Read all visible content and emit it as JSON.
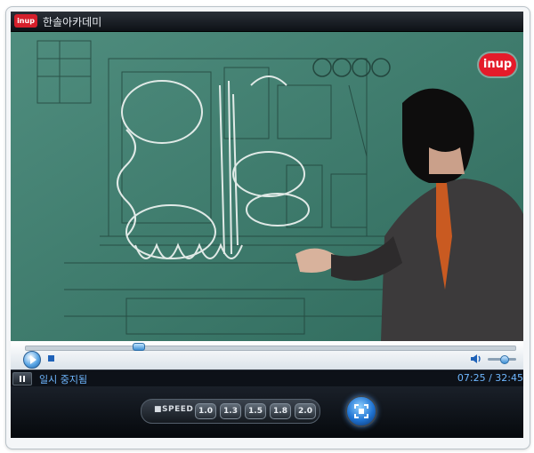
{
  "window": {
    "title": "한솔아카데미",
    "logo_text": "inup"
  },
  "video": {
    "brand_logo": "inup"
  },
  "controls": {
    "seek_progress": 0.23,
    "volume_level": 0.55
  },
  "status": {
    "state_text": "일시 중지됨",
    "time_text": "07:25 / 32:45"
  },
  "speed": {
    "label": "■SPEED",
    "options": [
      "1.0",
      "1.3",
      "1.5",
      "1.8",
      "2.0"
    ]
  },
  "colors": {
    "accent": "#3d8fd4",
    "status_text": "#6fb7ff",
    "brand_red": "#e41b2a"
  }
}
